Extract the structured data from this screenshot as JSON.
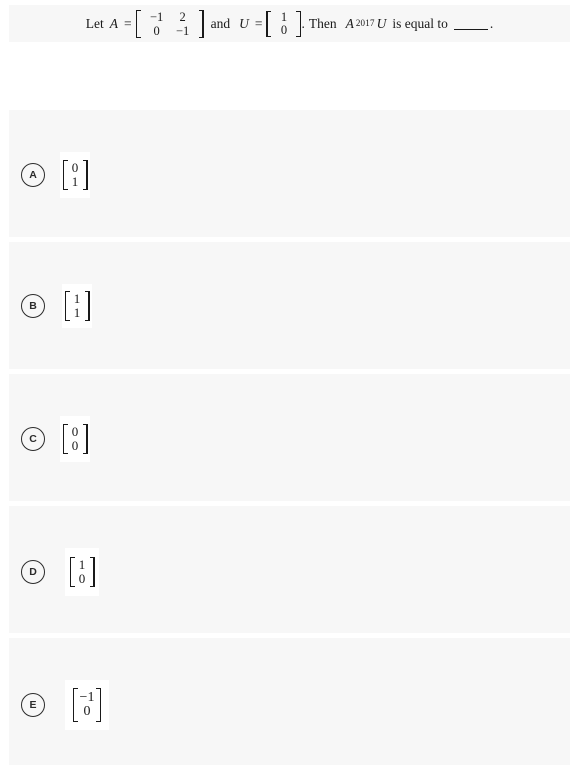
{
  "question": {
    "prefix": "Let",
    "var_a": "A",
    "eq1": "=",
    "matrix_a": {
      "rows": [
        [
          "−1",
          "2"
        ],
        [
          "0",
          "−1"
        ]
      ]
    },
    "conj": "and",
    "var_u": "U",
    "eq2": "=",
    "vector_u": {
      "rows": [
        [
          "1"
        ],
        [
          "0"
        ]
      ]
    },
    "period": ".",
    "then": "Then",
    "power_base": "A",
    "power_exp": "2017",
    "power_var": "U",
    "tail": "is equal to",
    "end_period": "."
  },
  "options": [
    {
      "letter": "A",
      "vector": {
        "rows": [
          [
            "0"
          ],
          [
            "1"
          ]
        ]
      }
    },
    {
      "letter": "B",
      "vector": {
        "rows": [
          [
            "1"
          ],
          [
            "1"
          ]
        ]
      }
    },
    {
      "letter": "C",
      "vector": {
        "rows": [
          [
            "0"
          ],
          [
            "0"
          ]
        ]
      }
    },
    {
      "letter": "D",
      "vector": {
        "rows": [
          [
            "1"
          ],
          [
            "0"
          ]
        ]
      }
    },
    {
      "letter": "E",
      "vector": {
        "rows": [
          [
            "−1"
          ],
          [
            "0"
          ]
        ]
      }
    }
  ],
  "colors": {
    "row_background": "#f7f7f7",
    "page_background": "#ffffff",
    "text": "#1a1a1a",
    "circle_border": "#2b2b2b"
  }
}
